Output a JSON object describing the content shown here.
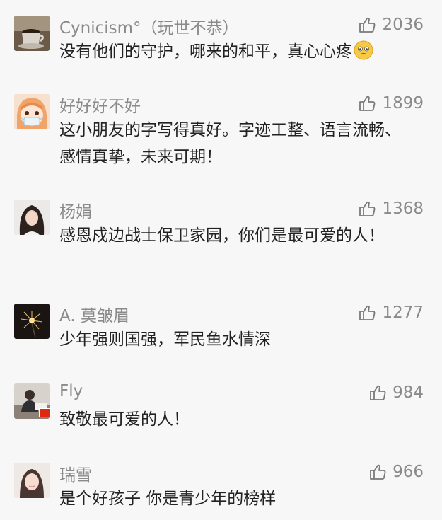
{
  "comments": [
    {
      "name": "Cynicism°（玩世不恭）",
      "likes": "2036",
      "text": "没有他们的守护，哪来的和平，真心心疼",
      "emoji": "worried-face-icon"
    },
    {
      "name": "好好好不好",
      "likes": "1899",
      "text": "这小朋友的字写得真好。字迹工整、语言流畅、感情真挚，未来可期！"
    },
    {
      "name": "杨娟",
      "likes": "1368",
      "text": "感恩戍边战士保卫家园，你们是最可爱的人！"
    },
    {
      "name": "A. 莫皱眉",
      "likes": "1277",
      "text": "少年强则国强，军民鱼水情深"
    },
    {
      "name": "Fly",
      "likes": "984",
      "text": "致敬最可爱的人！",
      "badge": "china-flag-icon"
    },
    {
      "name": "瑞雪",
      "likes": "966",
      "text": "是个好孩子  你是青少年的榜样"
    }
  ],
  "colors": {
    "background": "#f7f7f7",
    "name": "#8a8a8a",
    "text": "#222222"
  }
}
